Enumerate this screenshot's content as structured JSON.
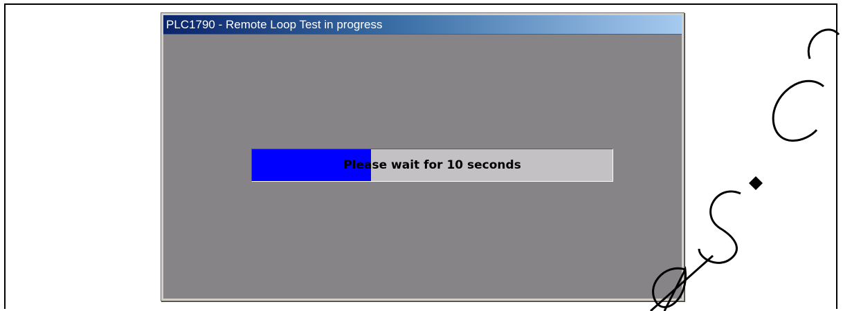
{
  "window": {
    "title": "PLC1790 - Remote Loop Test in progress"
  },
  "progress": {
    "text": "Please wait for 10 seconds",
    "fraction": 0.33,
    "fill_color": "#0000ff",
    "track_color": "#c3c1c4"
  },
  "colors": {
    "client_background": "#868487",
    "titlebar_start": "#0a246a",
    "titlebar_end": "#a6caf0"
  }
}
